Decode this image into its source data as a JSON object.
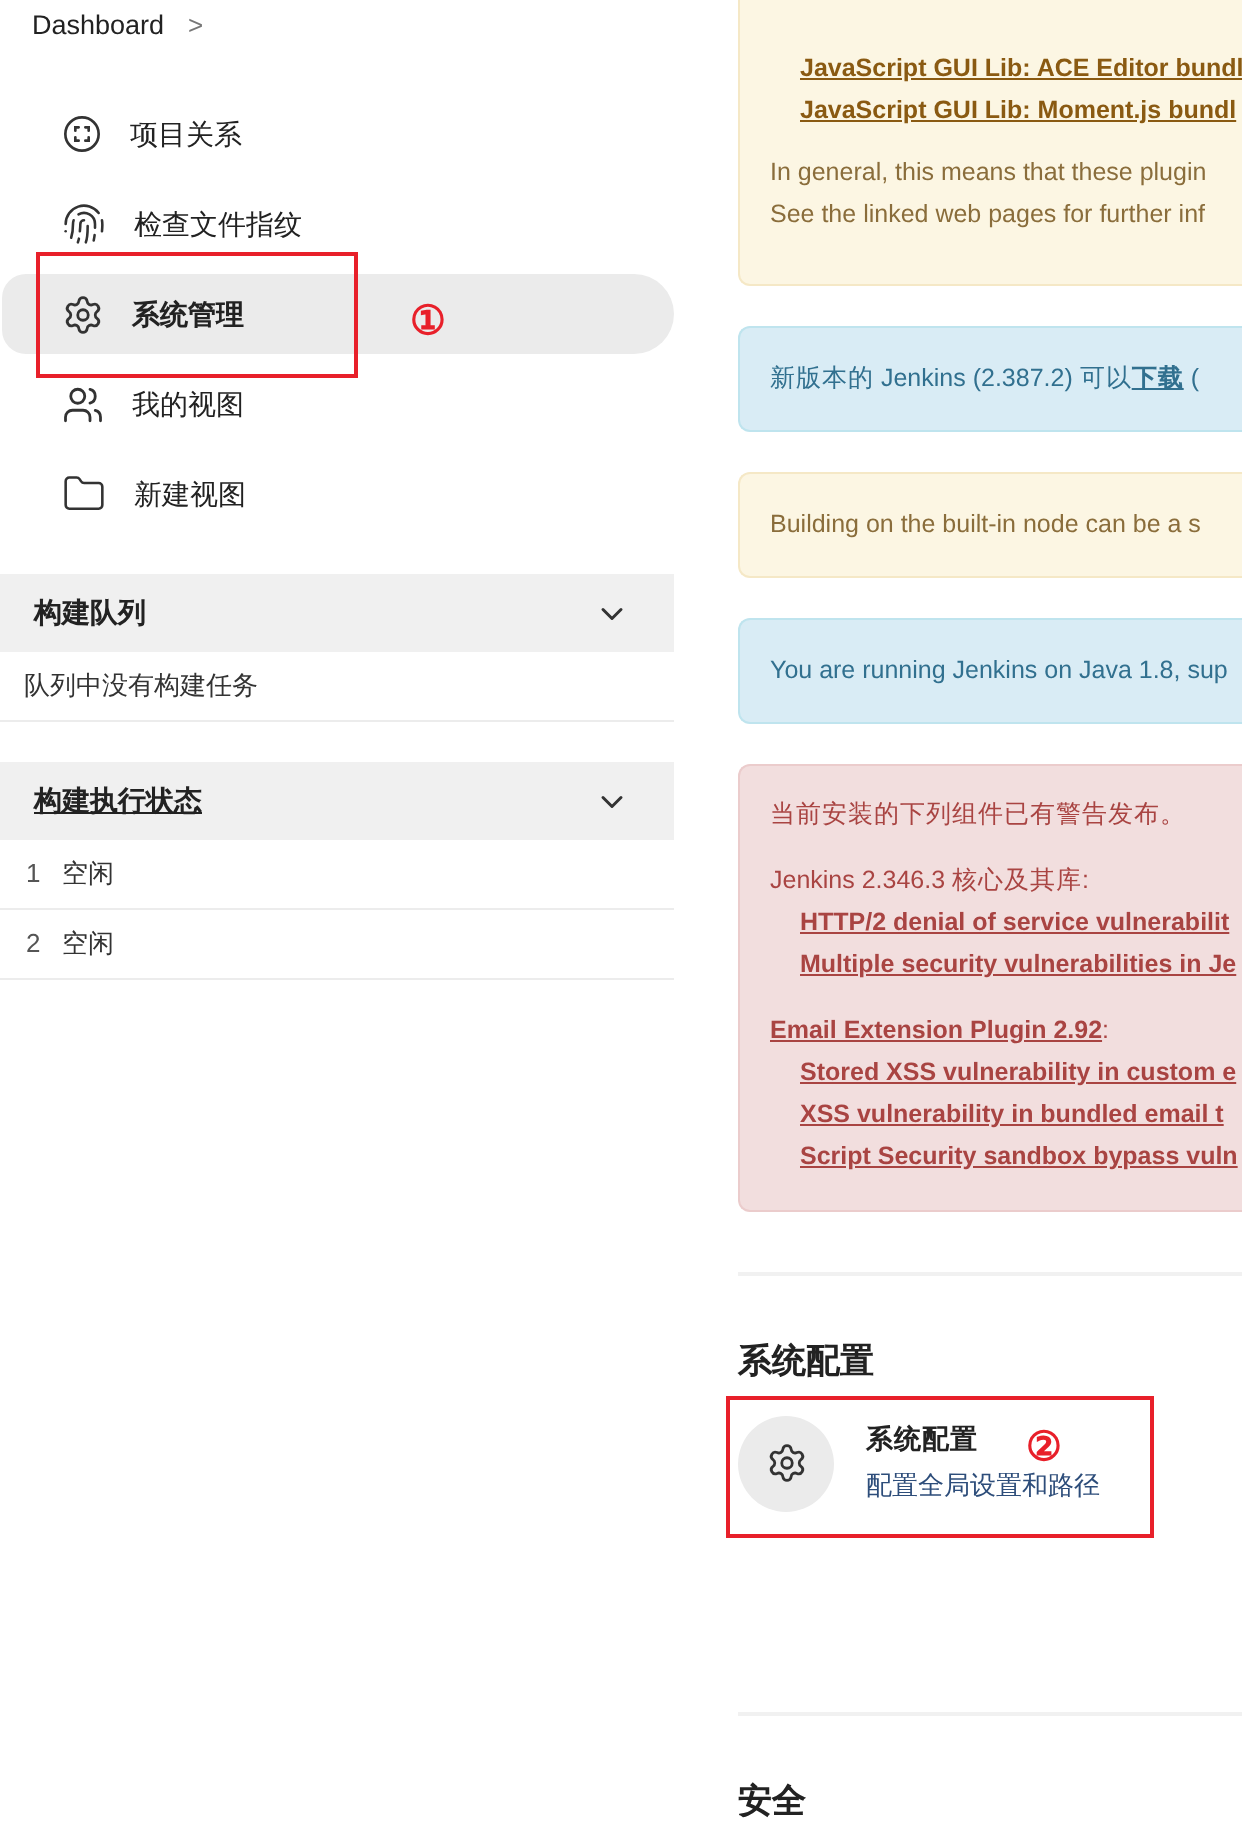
{
  "breadcrumb": {
    "label": "Dashboard",
    "separator": ">"
  },
  "sidebar": {
    "items": [
      {
        "label": "项目关系",
        "selected": false
      },
      {
        "label": "检查文件指纹",
        "selected": false
      },
      {
        "label": "系统管理",
        "selected": true
      },
      {
        "label": "我的视图",
        "selected": false
      },
      {
        "label": "新建视图",
        "selected": false
      }
    ]
  },
  "build_queue": {
    "title": "构建队列",
    "link": false,
    "expanded": true,
    "rows": [
      "队列中没有构建任务"
    ]
  },
  "executors": {
    "title": "构建执行状态",
    "link": true,
    "expanded": true,
    "rows": [
      {
        "number": "1",
        "status": "空闲"
      },
      {
        "number": "2",
        "status": "空闲"
      }
    ]
  },
  "plugin_notice": {
    "links": [
      "JavaScript GUI Lib: ACE Editor bundl",
      "JavaScript GUI Lib: Moment.js bundl"
    ],
    "lines": [
      "In general, this means that these plugin",
      "See the linked web pages for further inf"
    ]
  },
  "update_notice": {
    "text": "新版本的 Jenkins (2.387.2) 可以",
    "link": "下载",
    "after": " ("
  },
  "builtin_notice": {
    "text": "Building on the built-in node can be a s"
  },
  "java_notice": {
    "text": "You are running Jenkins on Java 1.8, sup"
  },
  "security_warnings": {
    "title": "当前安装的下列组件已有警告发布。",
    "groups": [
      {
        "name": "Jenkins 2.346.3 核心及其库:",
        "link": false,
        "items": [
          "HTTP/2 denial of service vulnerabilit",
          "Multiple security vulnerabilities in Je"
        ]
      },
      {
        "name": "Email Extension Plugin 2.92",
        "suffix": ":",
        "link": true,
        "items": [
          "Stored XSS vulnerability in custom e",
          "XSS vulnerability in bundled email t",
          "Script Security sandbox bypass vuln"
        ]
      }
    ]
  },
  "sections": [
    {
      "title": "系统配置",
      "tiles": [
        {
          "title": "系统配置",
          "description": "配置全局设置和路径"
        }
      ]
    },
    {
      "title": "安全"
    }
  ],
  "annotations": [
    {
      "label": "①"
    },
    {
      "label": "②"
    }
  ]
}
